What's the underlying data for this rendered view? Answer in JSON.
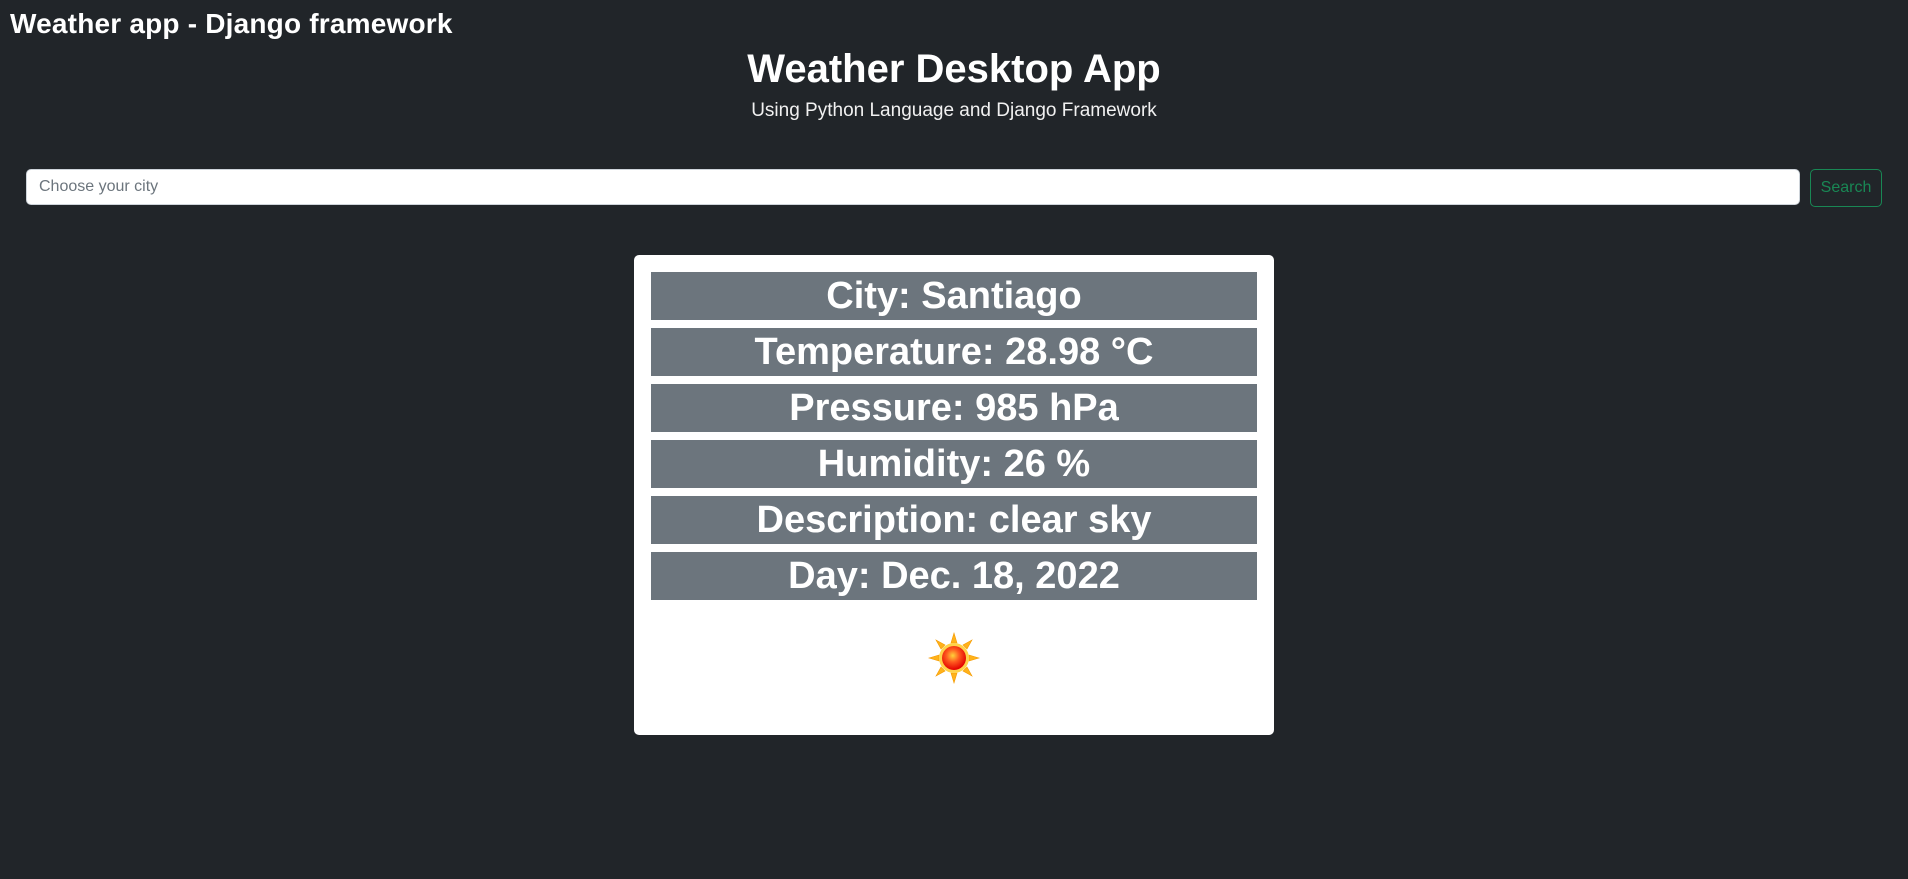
{
  "app": {
    "title": "Weather app - Django framework"
  },
  "hero": {
    "title": "Weather Desktop App",
    "subtitle": "Using Python Language and Django Framework"
  },
  "search": {
    "placeholder": "Choose your city",
    "value": "",
    "button_label": "Search"
  },
  "weather": {
    "city": {
      "label": "City:",
      "value": "Santiago"
    },
    "temperature": {
      "label": "Temperature:",
      "value": "28.98 °C"
    },
    "pressure": {
      "label": "Pressure:",
      "value": "985 hPa"
    },
    "humidity": {
      "label": "Humidity:",
      "value": "26 %"
    },
    "description": {
      "label": "Description:",
      "value": "clear sky"
    },
    "day": {
      "label": "Day:",
      "value": "Dec. 18, 2022"
    },
    "icon": "sun-icon"
  },
  "colors": {
    "background": "#212529",
    "row_background": "#6c757d",
    "search_accent": "#198754"
  }
}
